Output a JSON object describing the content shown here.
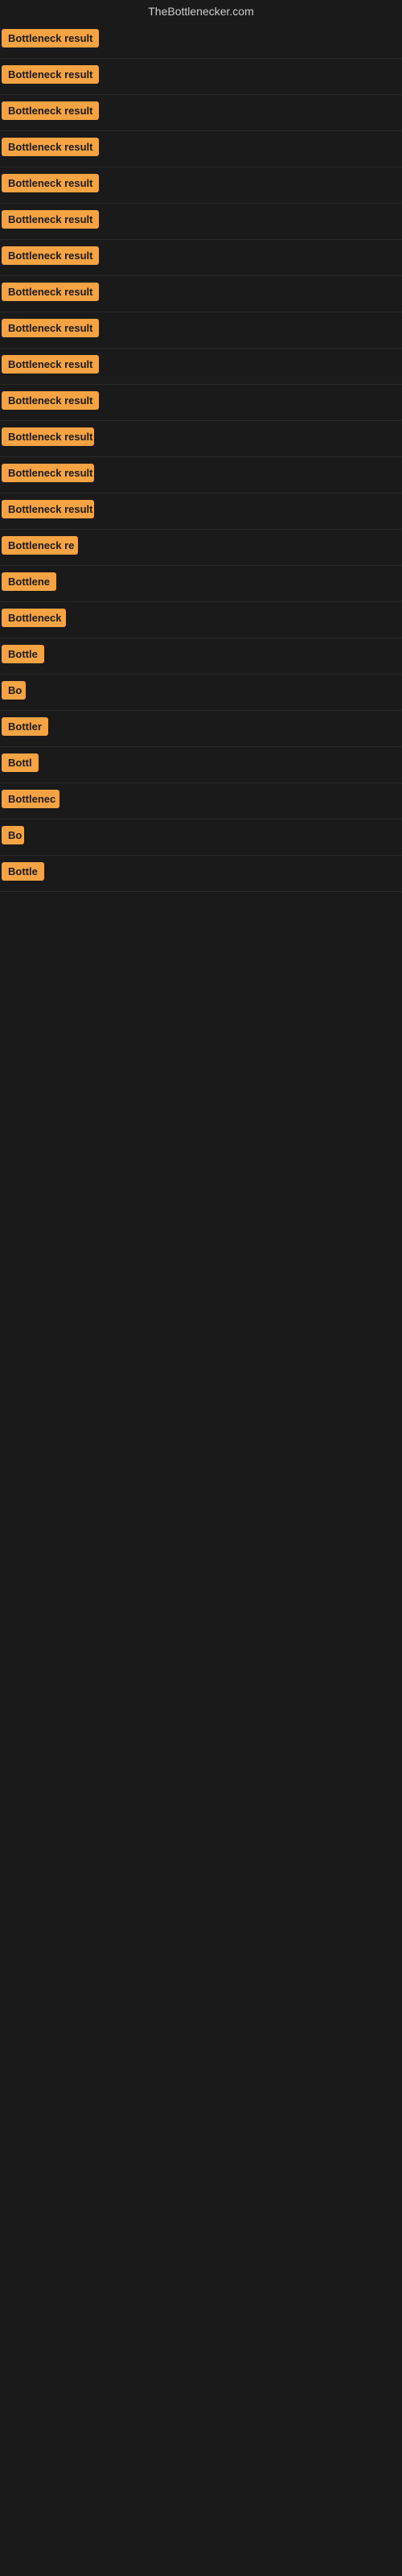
{
  "site": {
    "title": "TheBottlenecker.com"
  },
  "results": [
    {
      "id": 1,
      "label": "Bottleneck result",
      "width": 130
    },
    {
      "id": 2,
      "label": "Bottleneck result",
      "width": 130
    },
    {
      "id": 3,
      "label": "Bottleneck result",
      "width": 130
    },
    {
      "id": 4,
      "label": "Bottleneck result",
      "width": 130
    },
    {
      "id": 5,
      "label": "Bottleneck result",
      "width": 130
    },
    {
      "id": 6,
      "label": "Bottleneck result",
      "width": 130
    },
    {
      "id": 7,
      "label": "Bottleneck result",
      "width": 130
    },
    {
      "id": 8,
      "label": "Bottleneck result",
      "width": 130
    },
    {
      "id": 9,
      "label": "Bottleneck result",
      "width": 130
    },
    {
      "id": 10,
      "label": "Bottleneck result",
      "width": 130
    },
    {
      "id": 11,
      "label": "Bottleneck result",
      "width": 130
    },
    {
      "id": 12,
      "label": "Bottleneck result",
      "width": 115
    },
    {
      "id": 13,
      "label": "Bottleneck result",
      "width": 115
    },
    {
      "id": 14,
      "label": "Bottleneck result",
      "width": 115
    },
    {
      "id": 15,
      "label": "Bottleneck re",
      "width": 95
    },
    {
      "id": 16,
      "label": "Bottlene",
      "width": 75
    },
    {
      "id": 17,
      "label": "Bottleneck",
      "width": 80
    },
    {
      "id": 18,
      "label": "Bottle",
      "width": 60
    },
    {
      "id": 19,
      "label": "Bo",
      "width": 30
    },
    {
      "id": 20,
      "label": "Bottler",
      "width": 58
    },
    {
      "id": 21,
      "label": "Bottl",
      "width": 48
    },
    {
      "id": 22,
      "label": "Bottlenec",
      "width": 72
    },
    {
      "id": 23,
      "label": "Bo",
      "width": 28
    },
    {
      "id": 24,
      "label": "Bottle",
      "width": 54
    }
  ]
}
